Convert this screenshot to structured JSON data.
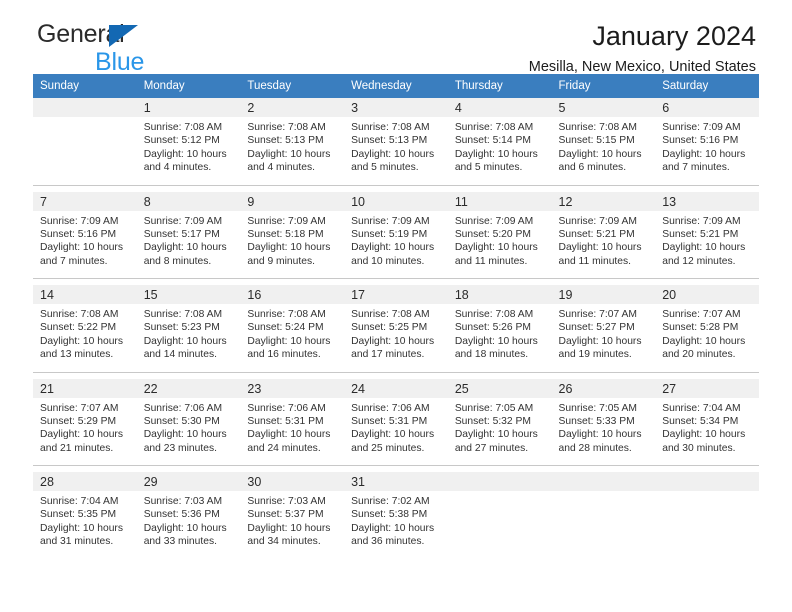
{
  "brand": {
    "name_top": "General",
    "name_bottom": "Blue",
    "triangle_color": "#1368b3",
    "bottom_color": "#2a96e8"
  },
  "header": {
    "title": "January 2024",
    "subtitle": "Mesilla, New Mexico, United States"
  },
  "theme": {
    "header_bg": "#3a7ebf",
    "header_text": "#ffffff",
    "daynum_bg": "#f0f0f0",
    "rule_color": "#c8c8c8"
  },
  "calendar": {
    "weekdays": [
      "Sunday",
      "Monday",
      "Tuesday",
      "Wednesday",
      "Thursday",
      "Friday",
      "Saturday"
    ],
    "weeks": [
      [
        {
          "day": "",
          "lines": []
        },
        {
          "day": "1",
          "lines": [
            "Sunrise: 7:08 AM",
            "Sunset: 5:12 PM",
            "Daylight: 10 hours",
            "and 4 minutes."
          ]
        },
        {
          "day": "2",
          "lines": [
            "Sunrise: 7:08 AM",
            "Sunset: 5:13 PM",
            "Daylight: 10 hours",
            "and 4 minutes."
          ]
        },
        {
          "day": "3",
          "lines": [
            "Sunrise: 7:08 AM",
            "Sunset: 5:13 PM",
            "Daylight: 10 hours",
            "and 5 minutes."
          ]
        },
        {
          "day": "4",
          "lines": [
            "Sunrise: 7:08 AM",
            "Sunset: 5:14 PM",
            "Daylight: 10 hours",
            "and 5 minutes."
          ]
        },
        {
          "day": "5",
          "lines": [
            "Sunrise: 7:08 AM",
            "Sunset: 5:15 PM",
            "Daylight: 10 hours",
            "and 6 minutes."
          ]
        },
        {
          "day": "6",
          "lines": [
            "Sunrise: 7:09 AM",
            "Sunset: 5:16 PM",
            "Daylight: 10 hours",
            "and 7 minutes."
          ]
        }
      ],
      [
        {
          "day": "7",
          "lines": [
            "Sunrise: 7:09 AM",
            "Sunset: 5:16 PM",
            "Daylight: 10 hours",
            "and 7 minutes."
          ]
        },
        {
          "day": "8",
          "lines": [
            "Sunrise: 7:09 AM",
            "Sunset: 5:17 PM",
            "Daylight: 10 hours",
            "and 8 minutes."
          ]
        },
        {
          "day": "9",
          "lines": [
            "Sunrise: 7:09 AM",
            "Sunset: 5:18 PM",
            "Daylight: 10 hours",
            "and 9 minutes."
          ]
        },
        {
          "day": "10",
          "lines": [
            "Sunrise: 7:09 AM",
            "Sunset: 5:19 PM",
            "Daylight: 10 hours",
            "and 10 minutes."
          ]
        },
        {
          "day": "11",
          "lines": [
            "Sunrise: 7:09 AM",
            "Sunset: 5:20 PM",
            "Daylight: 10 hours",
            "and 11 minutes."
          ]
        },
        {
          "day": "12",
          "lines": [
            "Sunrise: 7:09 AM",
            "Sunset: 5:21 PM",
            "Daylight: 10 hours",
            "and 11 minutes."
          ]
        },
        {
          "day": "13",
          "lines": [
            "Sunrise: 7:09 AM",
            "Sunset: 5:21 PM",
            "Daylight: 10 hours",
            "and 12 minutes."
          ]
        }
      ],
      [
        {
          "day": "14",
          "lines": [
            "Sunrise: 7:08 AM",
            "Sunset: 5:22 PM",
            "Daylight: 10 hours",
            "and 13 minutes."
          ]
        },
        {
          "day": "15",
          "lines": [
            "Sunrise: 7:08 AM",
            "Sunset: 5:23 PM",
            "Daylight: 10 hours",
            "and 14 minutes."
          ]
        },
        {
          "day": "16",
          "lines": [
            "Sunrise: 7:08 AM",
            "Sunset: 5:24 PM",
            "Daylight: 10 hours",
            "and 16 minutes."
          ]
        },
        {
          "day": "17",
          "lines": [
            "Sunrise: 7:08 AM",
            "Sunset: 5:25 PM",
            "Daylight: 10 hours",
            "and 17 minutes."
          ]
        },
        {
          "day": "18",
          "lines": [
            "Sunrise: 7:08 AM",
            "Sunset: 5:26 PM",
            "Daylight: 10 hours",
            "and 18 minutes."
          ]
        },
        {
          "day": "19",
          "lines": [
            "Sunrise: 7:07 AM",
            "Sunset: 5:27 PM",
            "Daylight: 10 hours",
            "and 19 minutes."
          ]
        },
        {
          "day": "20",
          "lines": [
            "Sunrise: 7:07 AM",
            "Sunset: 5:28 PM",
            "Daylight: 10 hours",
            "and 20 minutes."
          ]
        }
      ],
      [
        {
          "day": "21",
          "lines": [
            "Sunrise: 7:07 AM",
            "Sunset: 5:29 PM",
            "Daylight: 10 hours",
            "and 21 minutes."
          ]
        },
        {
          "day": "22",
          "lines": [
            "Sunrise: 7:06 AM",
            "Sunset: 5:30 PM",
            "Daylight: 10 hours",
            "and 23 minutes."
          ]
        },
        {
          "day": "23",
          "lines": [
            "Sunrise: 7:06 AM",
            "Sunset: 5:31 PM",
            "Daylight: 10 hours",
            "and 24 minutes."
          ]
        },
        {
          "day": "24",
          "lines": [
            "Sunrise: 7:06 AM",
            "Sunset: 5:31 PM",
            "Daylight: 10 hours",
            "and 25 minutes."
          ]
        },
        {
          "day": "25",
          "lines": [
            "Sunrise: 7:05 AM",
            "Sunset: 5:32 PM",
            "Daylight: 10 hours",
            "and 27 minutes."
          ]
        },
        {
          "day": "26",
          "lines": [
            "Sunrise: 7:05 AM",
            "Sunset: 5:33 PM",
            "Daylight: 10 hours",
            "and 28 minutes."
          ]
        },
        {
          "day": "27",
          "lines": [
            "Sunrise: 7:04 AM",
            "Sunset: 5:34 PM",
            "Daylight: 10 hours",
            "and 30 minutes."
          ]
        }
      ],
      [
        {
          "day": "28",
          "lines": [
            "Sunrise: 7:04 AM",
            "Sunset: 5:35 PM",
            "Daylight: 10 hours",
            "and 31 minutes."
          ]
        },
        {
          "day": "29",
          "lines": [
            "Sunrise: 7:03 AM",
            "Sunset: 5:36 PM",
            "Daylight: 10 hours",
            "and 33 minutes."
          ]
        },
        {
          "day": "30",
          "lines": [
            "Sunrise: 7:03 AM",
            "Sunset: 5:37 PM",
            "Daylight: 10 hours",
            "and 34 minutes."
          ]
        },
        {
          "day": "31",
          "lines": [
            "Sunrise: 7:02 AM",
            "Sunset: 5:38 PM",
            "Daylight: 10 hours",
            "and 36 minutes."
          ]
        },
        {
          "day": "",
          "lines": []
        },
        {
          "day": "",
          "lines": []
        },
        {
          "day": "",
          "lines": []
        }
      ]
    ]
  }
}
